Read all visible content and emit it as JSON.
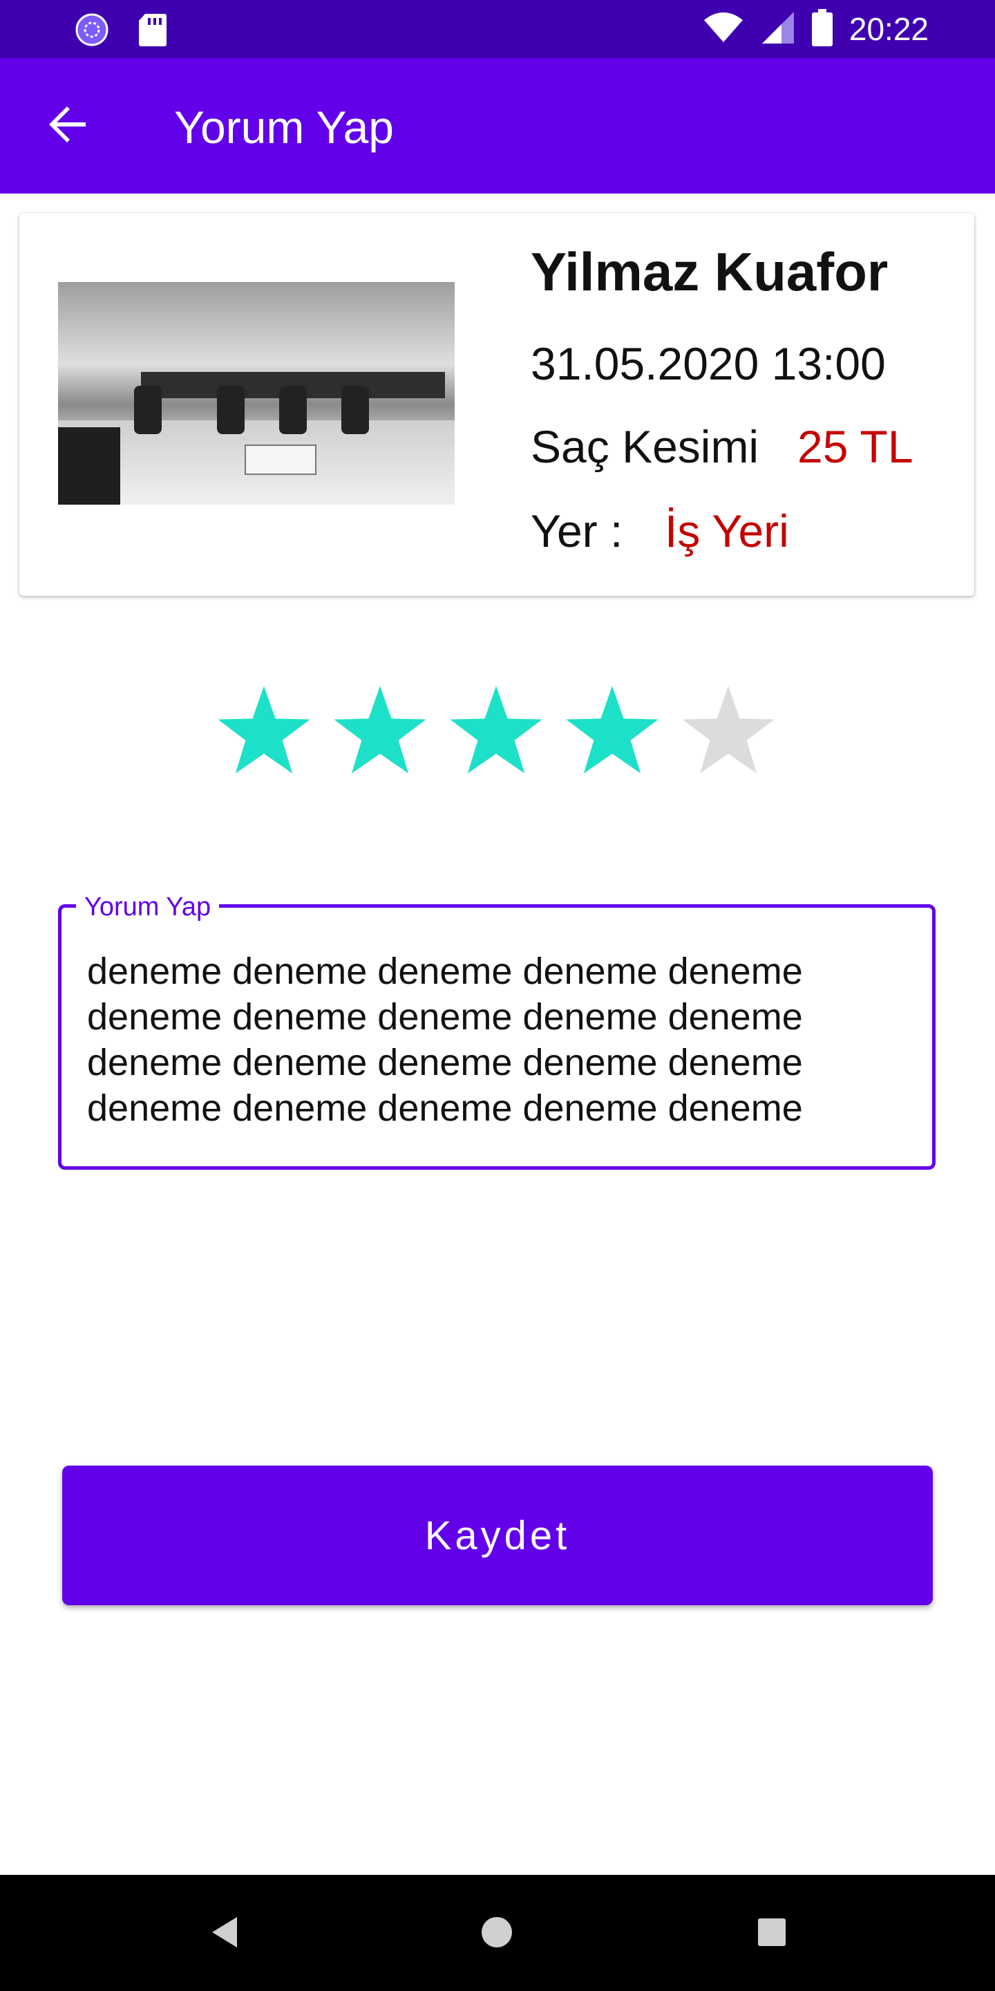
{
  "status_bar": {
    "time": "20:22",
    "icons": [
      "app-notification-icon",
      "sd-card-icon",
      "wifi-icon",
      "signal-icon",
      "battery-icon"
    ]
  },
  "app_bar": {
    "title": "Yorum Yap",
    "back_icon": "arrow-back-icon",
    "background": "#6200ea"
  },
  "appointment": {
    "salon_name": "Yilmaz Kuafor",
    "datetime": "31.05.2020 13:00",
    "service": "Saç Kesimi",
    "price": "25 TL",
    "place_label": "Yer :",
    "place": "İş Yeri",
    "highlight_color": "#c50000"
  },
  "rating": {
    "value": 4,
    "max": 5,
    "filled_color": "#1de0c8",
    "empty_color": "#dcdcdc"
  },
  "comment": {
    "label": "Yorum Yap",
    "value": "deneme deneme deneme deneme deneme deneme deneme deneme deneme deneme deneme deneme deneme deneme deneme deneme deneme deneme deneme deneme"
  },
  "save_button": {
    "label": "Kaydet"
  },
  "nav_bar": {
    "icons": [
      "back-triangle-icon",
      "home-circle-icon",
      "recents-square-icon"
    ]
  }
}
